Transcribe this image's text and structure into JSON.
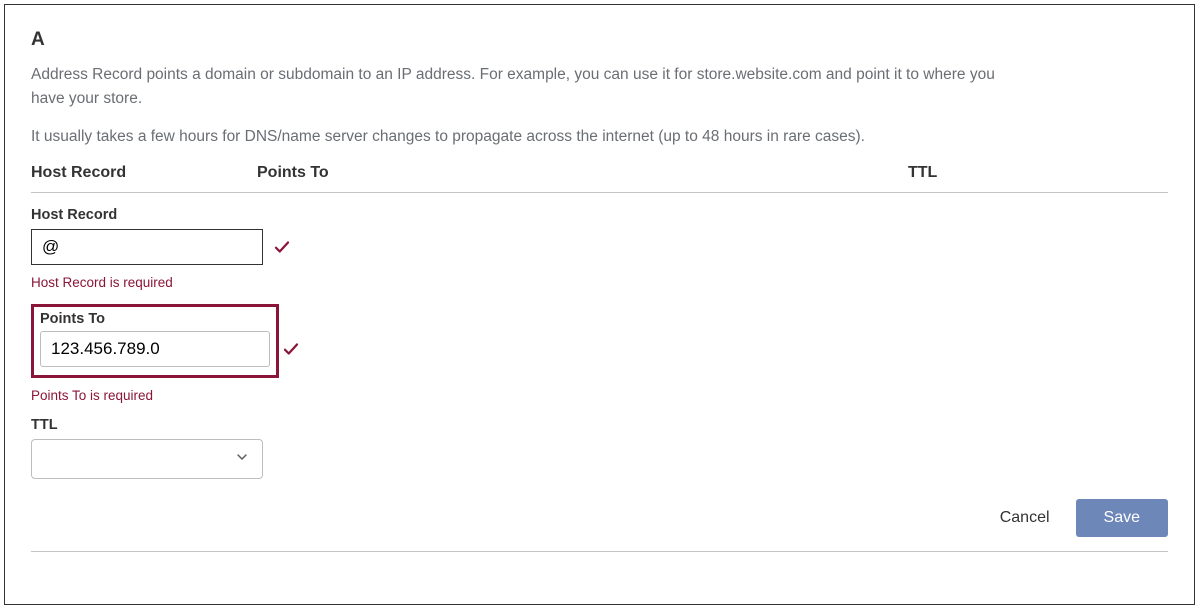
{
  "header": {
    "title": "A",
    "description1": "Address Record points a domain or subdomain to an IP address. For example, you can use it for store.website.com and point it to where you have your store.",
    "description2": "It usually takes a few hours for DNS/name server changes to propagate across the internet (up to 48 hours in rare cases)."
  },
  "columns": {
    "host": "Host Record",
    "points_to": "Points To",
    "ttl": "TTL"
  },
  "fields": {
    "host_record": {
      "label": "Host Record",
      "value": "@",
      "error": "Host Record is required"
    },
    "points_to": {
      "label": "Points To",
      "value": "123.456.789.0",
      "error": "Points To is required"
    },
    "ttl": {
      "label": "TTL",
      "value": ""
    }
  },
  "actions": {
    "cancel": "Cancel",
    "save": "Save"
  }
}
